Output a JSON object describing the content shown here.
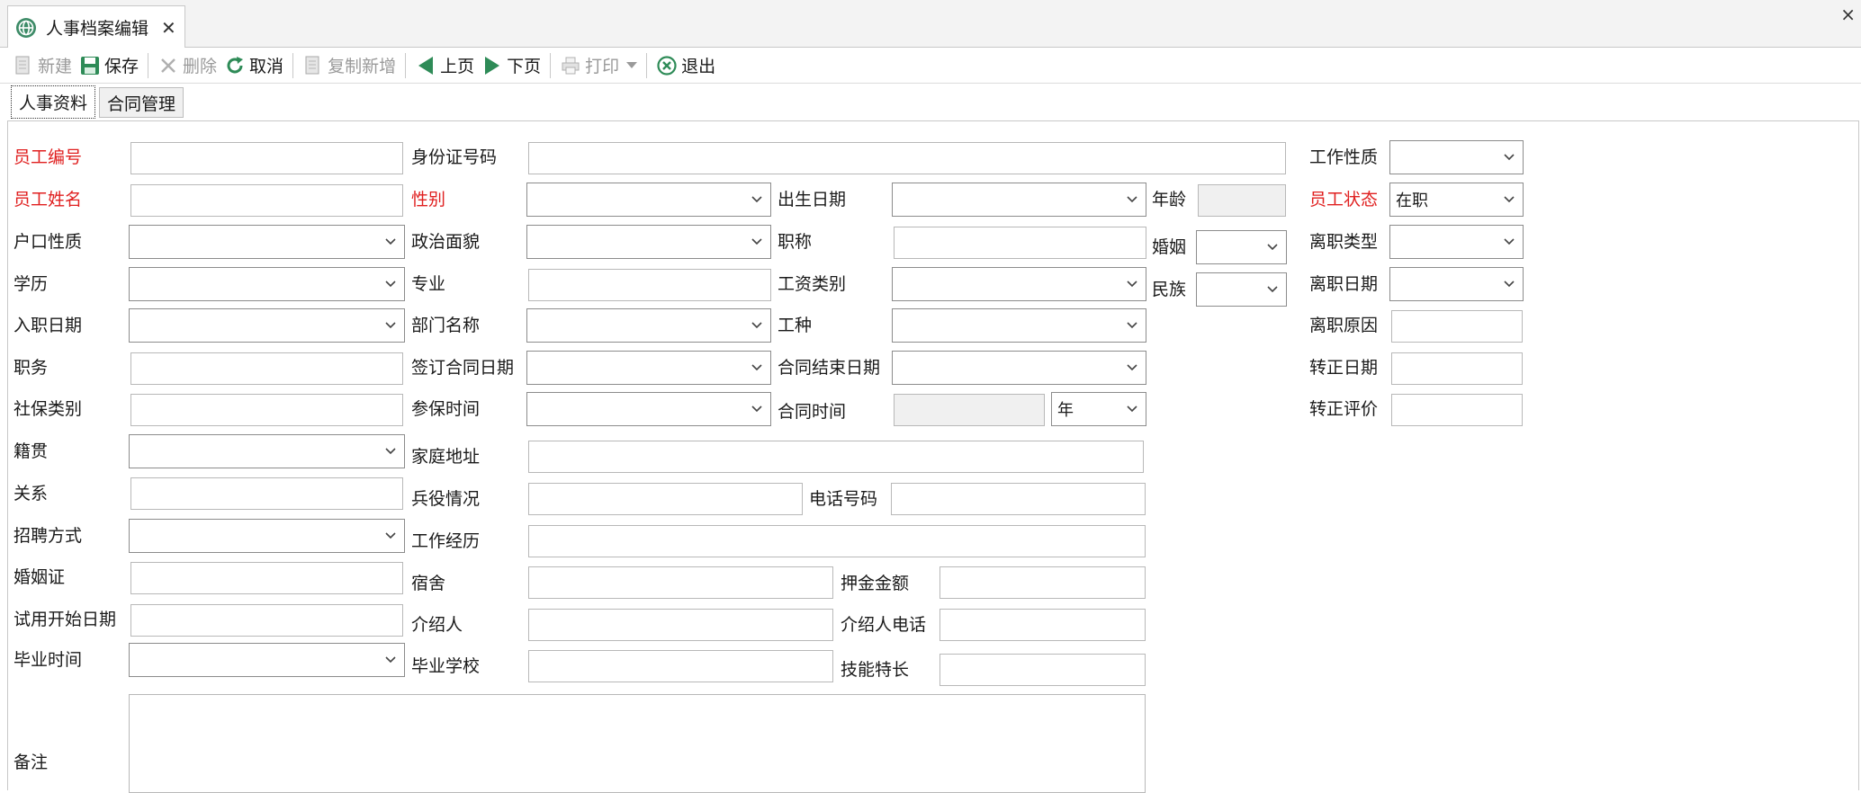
{
  "window": {
    "tab_title": "人事档案编辑",
    "tab_close": "✕",
    "window_close": "×"
  },
  "toolbar": {
    "new": "新建",
    "save": "保存",
    "delete": "删除",
    "cancel": "取消",
    "copy_new": "复制新增",
    "prev": "上页",
    "next": "下页",
    "print": "打印",
    "exit": "退出"
  },
  "subtabs": {
    "personnel": "人事资料",
    "contract": "合同管理"
  },
  "labels": {
    "emp_no": "员工编号",
    "id_no": "身份证号码",
    "work_nature": "工作性质",
    "emp_name": "员工姓名",
    "gender": "性别",
    "birth_date": "出生日期",
    "age": "年龄",
    "emp_status": "员工状态",
    "hukou": "户口性质",
    "political": "政治面貌",
    "title": "职称",
    "marriage": "婚姻",
    "resign_type": "离职类型",
    "education": "学历",
    "major": "专业",
    "salary_type": "工资类别",
    "ethnic": "民族",
    "resign_date": "离职日期",
    "join_date": "入职日期",
    "dept": "部门名称",
    "work_type": "工种",
    "resign_reason": "离职原因",
    "duty": "职务",
    "contract_sign": "签订合同日期",
    "contract_end": "合同结束日期",
    "regular_date": "转正日期",
    "social_type": "社保类别",
    "insured_time": "参保时间",
    "contract_period": "合同时间",
    "regular_eval": "转正评价",
    "native": "籍贯",
    "address": "家庭地址",
    "relation": "关系",
    "military": "兵役情况",
    "phone": "电话号码",
    "recruit": "招聘方式",
    "experience": "工作经历",
    "marriage_cert": "婚姻证",
    "dorm": "宿舍",
    "deposit": "押金金额",
    "trial_start": "试用开始日期",
    "introducer": "介绍人",
    "introducer_phone": "介绍人电话",
    "grad_time": "毕业时间",
    "school": "毕业学校",
    "skill": "技能特长",
    "remark": "备注"
  },
  "values": {
    "emp_status": "在职",
    "period_unit": "年"
  },
  "colors": {
    "required": "#e02020",
    "accent": "#2e8b57"
  }
}
